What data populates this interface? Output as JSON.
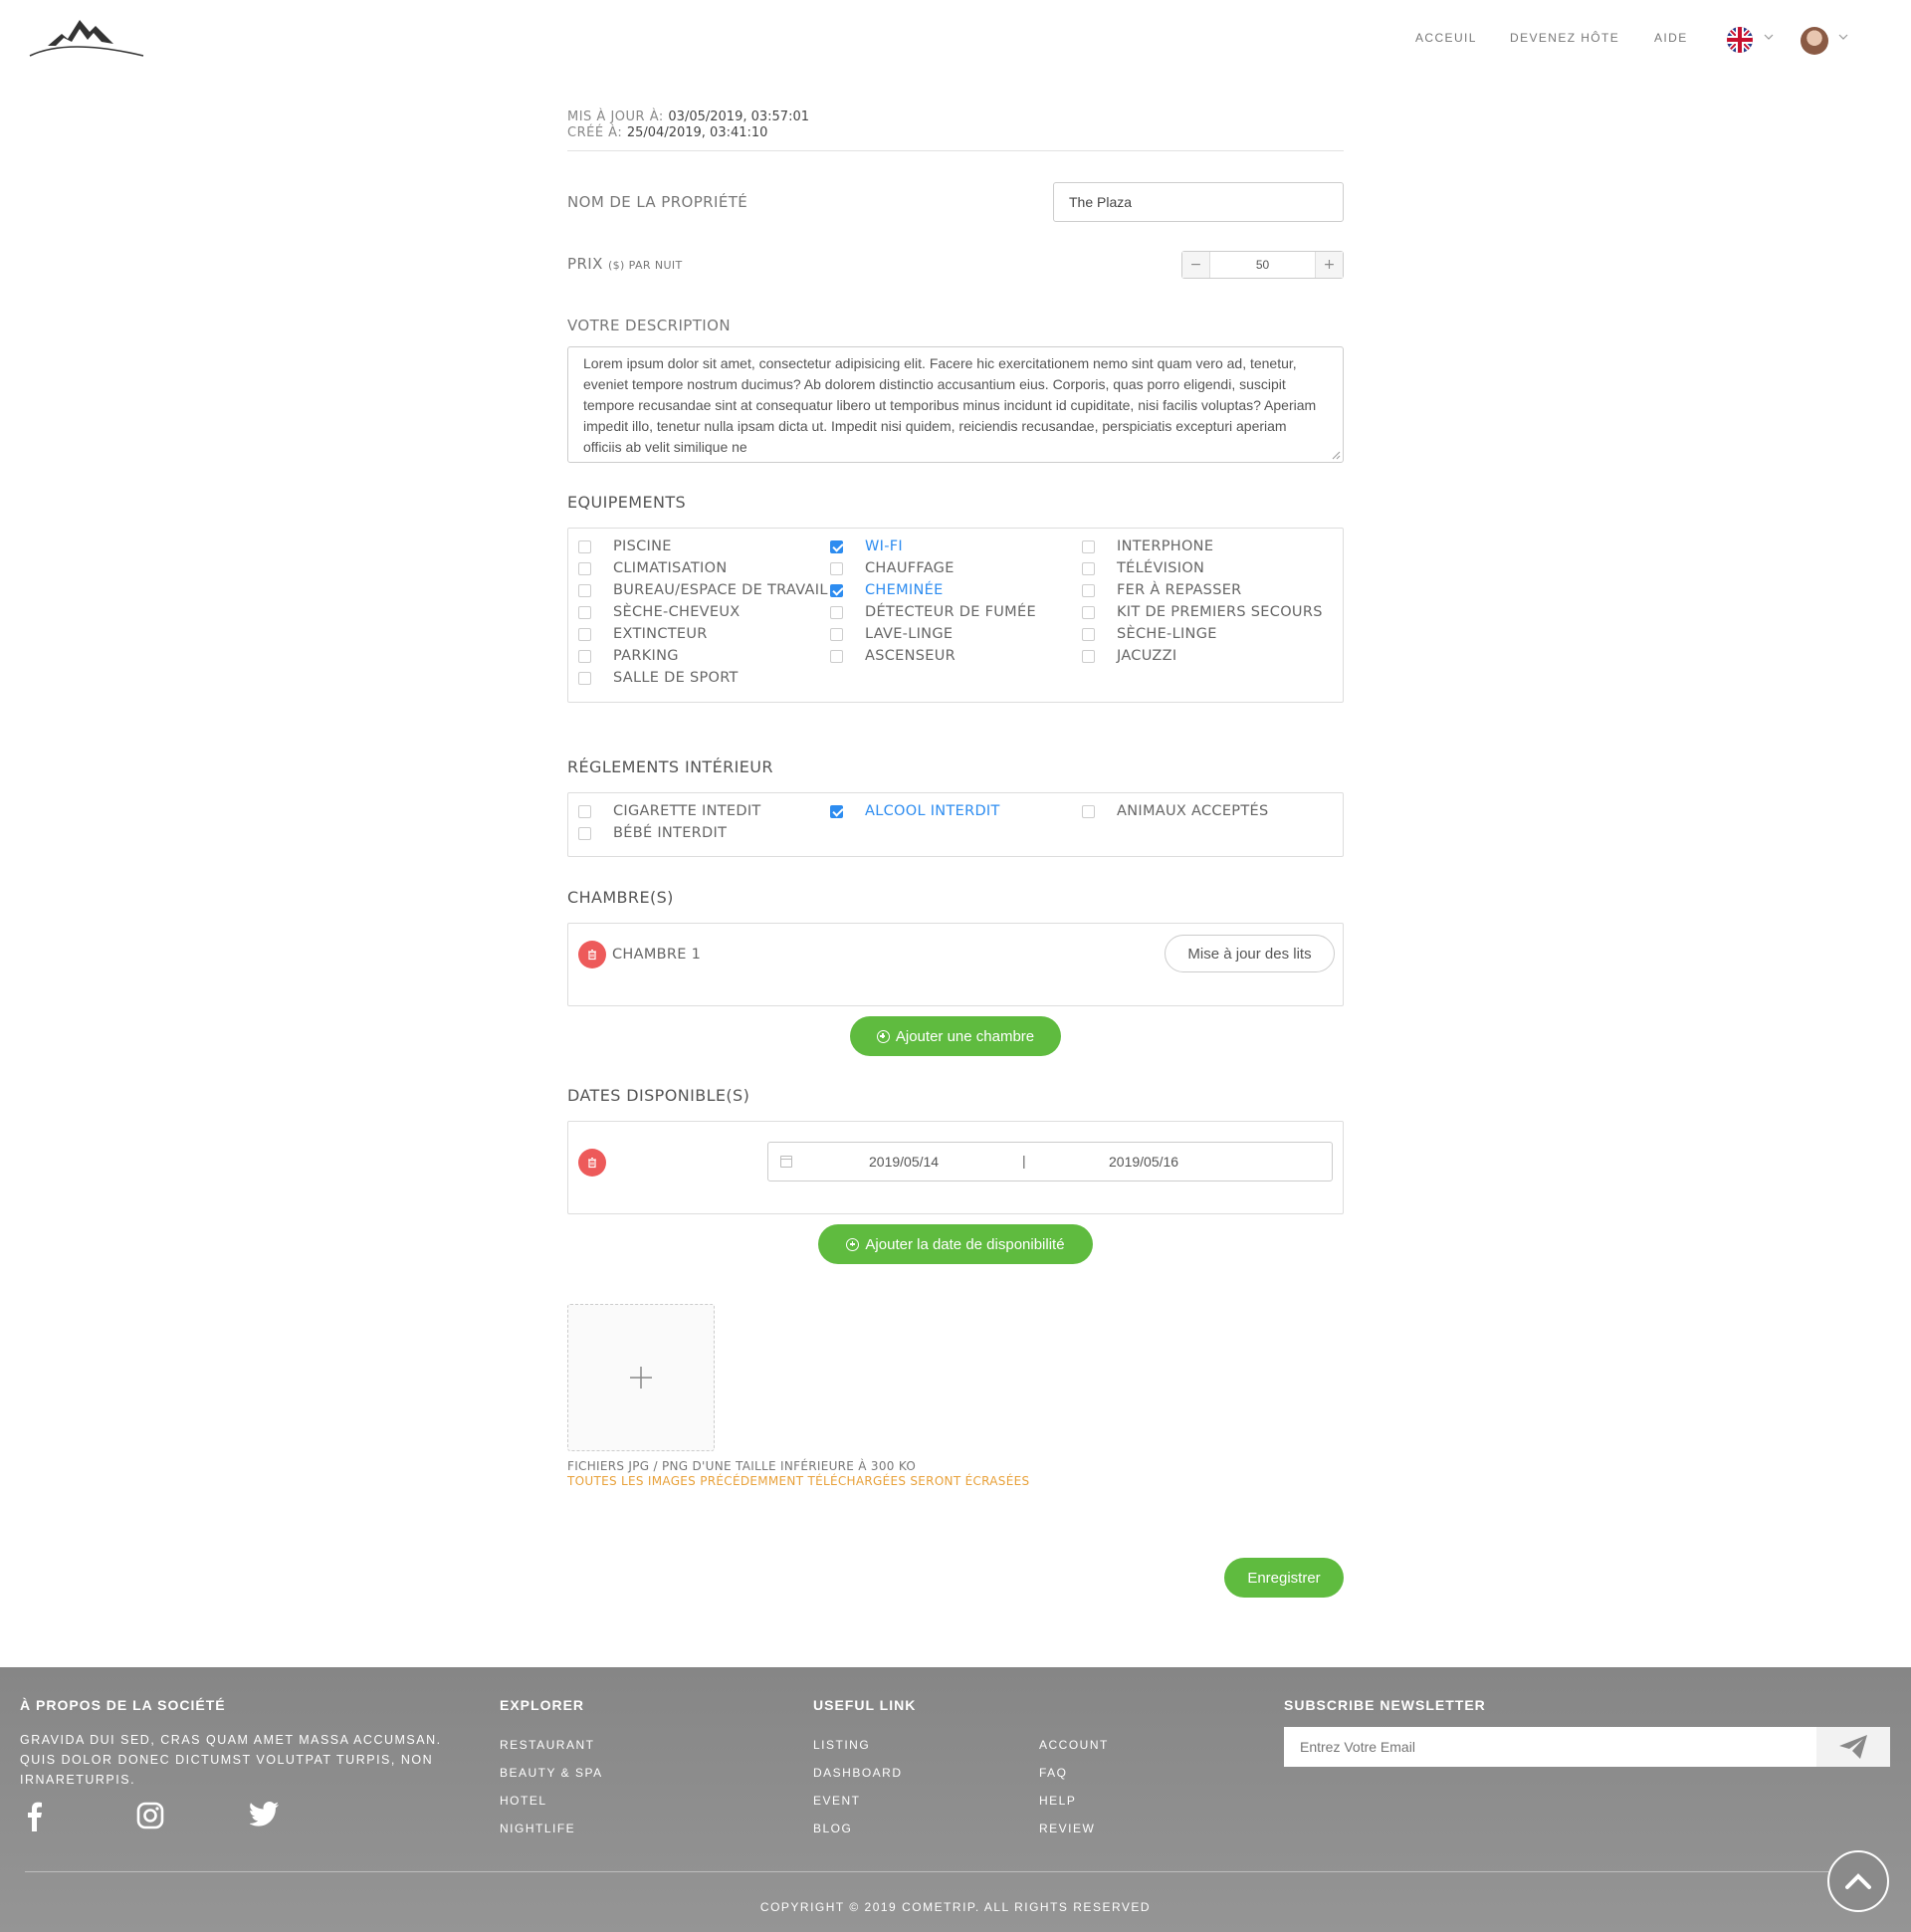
{
  "header": {
    "nav": [
      "ACCEUIL",
      "DEVENEZ HÔTE",
      "AIDE"
    ]
  },
  "meta": {
    "updated_label": "MIS À JOUR À:",
    "updated_value": "03/05/2019, 03:57:01",
    "created_label": "CRÉÉ À:",
    "created_value": "25/04/2019, 03:41:10"
  },
  "form": {
    "name_label": "NOM DE LA PROPRIÉTÉ",
    "name_value": "The Plaza",
    "price_label": "PRIX",
    "price_unit": "($) PAR NUIT",
    "price_value": "50",
    "price_minus": "−",
    "price_plus": "+",
    "description_label": "VOTRE DESCRIPTION",
    "description_value": "Lorem ipsum dolor sit amet, consectetur adipisicing elit. Facere hic exercitationem nemo sint quam vero ad, tenetur, eveniet tempore nostrum ducimus? Ab dolorem distinctio accusantium eius. Corporis, quas porro eligendi, suscipit tempore recusandae sint at consequatur libero ut temporibus minus incidunt id cupiditate, nisi facilis voluptas? Aperiam impedit illo, tenetur nulla ipsam dicta ut. Impedit nisi quidem, reiciendis recusandae, perspiciatis excepturi aperiam officiis ab velit similique ne"
  },
  "amenities": {
    "title": "EQUIPEMENTS",
    "items": [
      {
        "label": "PISCINE",
        "checked": false
      },
      {
        "label": "WI-FI",
        "checked": true
      },
      {
        "label": "INTERPHONE",
        "checked": false
      },
      {
        "label": "CLIMATISATION",
        "checked": false
      },
      {
        "label": "CHAUFFAGE",
        "checked": false
      },
      {
        "label": "TÉLÉVISION",
        "checked": false
      },
      {
        "label": "BUREAU/ESPACE DE TRAVAIL",
        "checked": false
      },
      {
        "label": "CHEMINÉE",
        "checked": true
      },
      {
        "label": "FER À REPASSER",
        "checked": false
      },
      {
        "label": "SÈCHE-CHEVEUX",
        "checked": false
      },
      {
        "label": "DÉTECTEUR DE FUMÉE",
        "checked": false
      },
      {
        "label": "KIT DE PREMIERS SECOURS",
        "checked": false
      },
      {
        "label": "EXTINCTEUR",
        "checked": false
      },
      {
        "label": "LAVE-LINGE",
        "checked": false
      },
      {
        "label": "SÈCHE-LINGE",
        "checked": false
      },
      {
        "label": "PARKING",
        "checked": false
      },
      {
        "label": "ASCENSEUR",
        "checked": false
      },
      {
        "label": "JACUZZI",
        "checked": false
      },
      {
        "label": "SALLE DE SPORT",
        "checked": false
      }
    ]
  },
  "rules": {
    "title": "RÉGLEMENTS INTÉRIEUR",
    "items": [
      {
        "label": "CIGARETTE INTEDIT",
        "checked": false
      },
      {
        "label": "ALCOOL INTERDIT",
        "checked": true
      },
      {
        "label": "ANIMAUX ACCEPTÉS",
        "checked": false
      },
      {
        "label": "BÉBÉ INTERDIT",
        "checked": false
      }
    ]
  },
  "rooms": {
    "title": "CHAMBRE(S)",
    "room_label": "CHAMBRE 1",
    "update_beds": "Mise à jour des lits",
    "add_room": "Ajouter une chambre"
  },
  "dates": {
    "title": "DATES DISPONIBLE(S)",
    "start": "2019/05/14",
    "separator": "|",
    "end": "2019/05/16",
    "add_date": "Ajouter la date de disponibilité"
  },
  "upload": {
    "hint": "FICHIERS JPG / PNG D'UNE TAILLE INFÉRIEURE À 300 KO",
    "warning": "TOUTES LES IMAGES PRÉCÉDEMMENT TÉLÉCHARGÉES SERONT ÉCRASÉES"
  },
  "save_label": "Enregistrer",
  "footer": {
    "about_title": "À PROPOS DE LA SOCIÉTÉ",
    "about_text": "GRAVIDA DUI SED, CRAS QUAM AMET MASSA ACCUMSAN. QUIS DOLOR DONEC DICTUMST VOLUTPAT TURPIS, NON IRNARETURPIS.",
    "explorer_title": "EXPLORER",
    "explorer_links": [
      "RESTAURANT",
      "BEAUTY & SPA",
      "HOTEL",
      "NIGHTLIFE"
    ],
    "useful_title": "USEFUL LINK",
    "useful_links_1": [
      "LISTING",
      "DASHBOARD",
      "EVENT",
      "BLOG"
    ],
    "useful_links_2": [
      "ACCOUNT",
      "FAQ",
      "HELP",
      "REVIEW"
    ],
    "newsletter_title": "SUBSCRIBE NEWSLETTER",
    "newsletter_placeholder": "Entrez Votre Email",
    "copyright": "COPYRIGHT © 2019 COMETRIP. ALL RIGHTS RESERVED"
  },
  "colors": {
    "accent_green": "#5fbb3f",
    "checkbox_blue": "#2d8cf0",
    "delete_red": "#ed5a5a",
    "warning_orange": "#e8a13a"
  }
}
